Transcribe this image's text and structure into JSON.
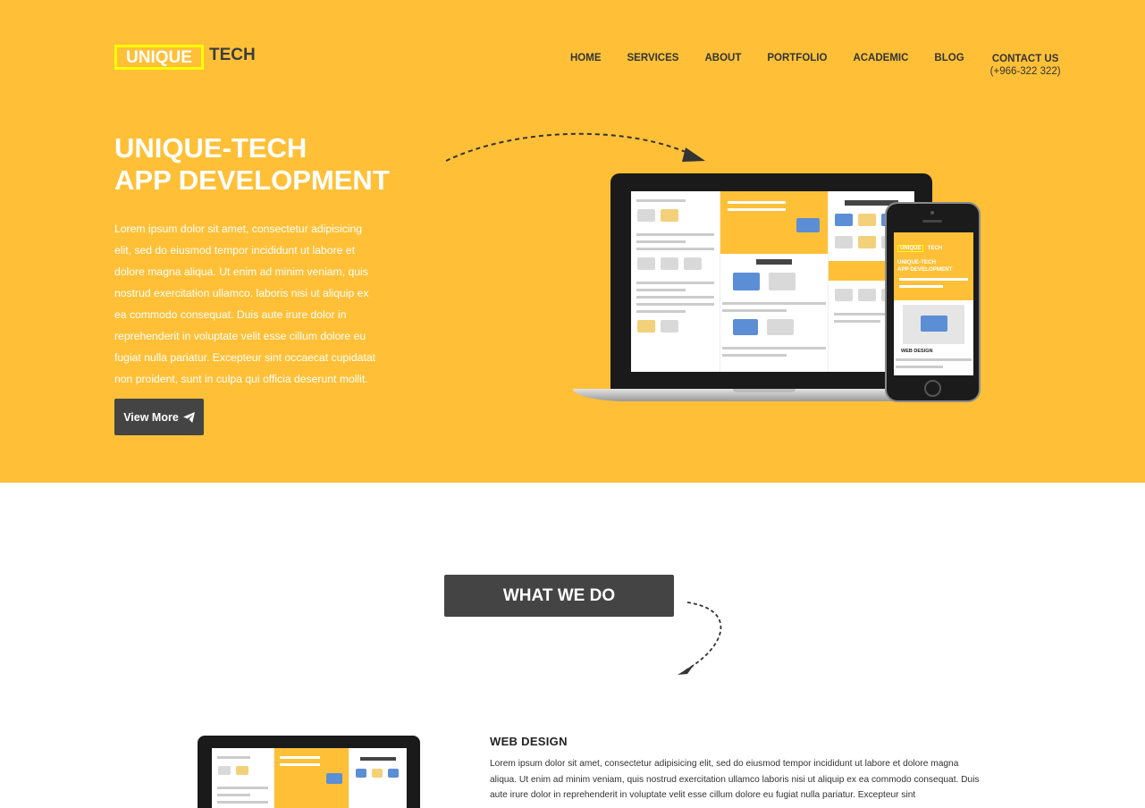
{
  "brand": {
    "logo_box": "UNIQUE",
    "logo_text": "TECH",
    "accent": "#ffc038",
    "logo_border": "#ffff00",
    "dark": "#444444"
  },
  "nav": {
    "items": [
      {
        "label": "HOME"
      },
      {
        "label": "SERVICES"
      },
      {
        "label": "ABOUT"
      },
      {
        "label": "PORTFOLIO"
      },
      {
        "label": "ACADEMIC"
      },
      {
        "label": "BLOG"
      }
    ],
    "contact_label": "CONTACT US",
    "contact_phone": "(+966-322 322)"
  },
  "hero": {
    "title_line1": "UNIQUE-TECH",
    "title_line2": "APP DEVELOPMENT",
    "body": "Lorem ipsum dolor sit amet, consectetur adipisicing elit, sed do eiusmod tempor incididunt ut labore et dolore magna aliqua. Ut enim ad minim veniam, quis nostrud exercitation ullamco. laboris nisi ut aliquip ex ea commodo consequat. Duis aute irure dolor in reprehenderit in voluptate velit esse cillum dolore eu fugiat nulla pariatur. Excepteur sint occaecat cupidatat non proident, sunt in culpa qui officia deserunt mollit.",
    "button_label": "View More",
    "button_icon": "paper-plane-icon"
  },
  "phone_mockup": {
    "logo_box": "UNIQUE",
    "logo_text": "TECH",
    "title_line1": "UNIQUE-TECH",
    "title_line2": "APP DEVELOPMENT",
    "section_title": "WEB DESIGN"
  },
  "services": {
    "heading": "WHAT WE DO",
    "items": [
      {
        "title": "WEB DESIGN",
        "body": "Lorem ipsum dolor sit amet, consectetur adipisicing elit, sed do eiusmod tempor incididunt ut labore et dolore magna aliqua. Ut enim ad minim veniam, quis nostrud exercitation ullamco laboris nisi ut aliquip ex ea commodo consequat. Duis aute irure dolor in reprehenderit in voluptate velit esse cillum dolore eu fugiat nulla pariatur. Excepteur sint"
      }
    ]
  }
}
